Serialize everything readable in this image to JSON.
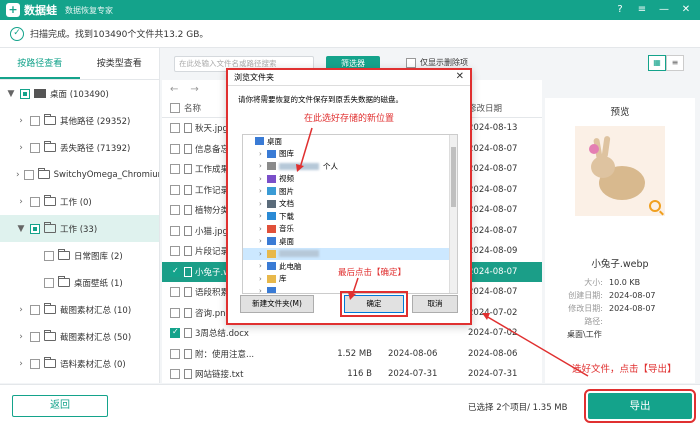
{
  "app": {
    "logo_glyph": "+",
    "name": "数据蛙",
    "subtitle": "数据恢复专家"
  },
  "window_controls": [
    "?",
    "≡",
    "—",
    "✕"
  ],
  "status": {
    "text": "扫描完成。找到103490个文件共13.2 GB。"
  },
  "left_tabs": [
    {
      "label": "按路径查看",
      "active": true
    },
    {
      "label": "按类型查看",
      "active": false
    }
  ],
  "tree": [
    {
      "label": "桌面 (103490)",
      "chevron": "▼",
      "check": "partial",
      "icon": "desktop"
    },
    {
      "label": "其他路径 (29352)",
      "chevron": "›",
      "check": "none",
      "icon": "folder"
    },
    {
      "label": "丢失路径 (71392)",
      "chevron": "›",
      "check": "none",
      "icon": "folder"
    },
    {
      "label": "SwitchyOmega_Chromium",
      "chevron": "›",
      "check": "none",
      "icon": "folder"
    },
    {
      "label": "工作 (0)",
      "chevron": "›",
      "check": "none",
      "icon": "folder"
    },
    {
      "label": "工作 (33)",
      "chevron": "▼",
      "check": "partial",
      "icon": "folder",
      "selected": true
    },
    {
      "label": "日常图库 (2)",
      "chevron": "",
      "check": "none",
      "icon": "folder"
    },
    {
      "label": "桌面壁纸 (1)",
      "chevron": "",
      "check": "none",
      "icon": "folder"
    },
    {
      "label": "截图素材汇总 (10)",
      "chevron": "›",
      "check": "none",
      "icon": "folder"
    },
    {
      "label": "截图素材汇总 (50)",
      "chevron": "›",
      "check": "none",
      "icon": "folder"
    },
    {
      "label": "语料素材汇总 (0)",
      "chevron": "›",
      "check": "none",
      "icon": "folder"
    }
  ],
  "toolbar": {
    "search_placeholder": "在此处输入文件名或路径搜索",
    "filter_label": "筛选器",
    "only_deleted_label": "仅显示删除项",
    "view_icons": [
      "▦",
      "≡"
    ]
  },
  "nav": {
    "back": "←",
    "forward": "→"
  },
  "file_list": {
    "headers": {
      "name": "名称",
      "size": "",
      "created": "",
      "modified": "修改日期"
    },
    "rows": [
      {
        "name": "秋天.jpg",
        "size": "",
        "created": "",
        "modified": "2024-08-13",
        "checked": false,
        "selected": false
      },
      {
        "name": "信息备忘.t",
        "size": "",
        "created": "",
        "modified": "2024-08-07",
        "checked": false,
        "selected": false
      },
      {
        "name": "工作成果分",
        "size": "",
        "created": "",
        "modified": "2024-08-07",
        "checked": false,
        "selected": false
      },
      {
        "name": "工作记录表",
        "size": "",
        "created": "",
        "modified": "2024-08-07",
        "checked": false,
        "selected": false
      },
      {
        "name": "植物分类.d",
        "size": "",
        "created": "",
        "modified": "2024-08-07",
        "checked": false,
        "selected": false
      },
      {
        "name": "小猫.jpg",
        "size": "",
        "created": "",
        "modified": "2024-08-07",
        "checked": false,
        "selected": false
      },
      {
        "name": "片段记录.c",
        "size": "",
        "created": "",
        "modified": "2024-08-09",
        "checked": false,
        "selected": false
      },
      {
        "name": "小兔子.we",
        "size": "",
        "created": "",
        "modified": "2024-08-07",
        "checked": true,
        "selected": true
      },
      {
        "name": "语段积累.d",
        "size": "",
        "created": "",
        "modified": "2024-08-07",
        "checked": false,
        "selected": false
      },
      {
        "name": "咨询.png",
        "size": "",
        "created": "",
        "modified": "2024-07-02",
        "checked": false,
        "selected": false
      },
      {
        "name": "3周总结.docx",
        "size": "",
        "created": "",
        "modified": "2024-07-02",
        "checked": true,
        "selected": false
      },
      {
        "name": "附：使用注意...",
        "size": "1.52 MB",
        "created": "2024-08-06",
        "modified": "2024-08-06",
        "checked": false,
        "selected": false
      },
      {
        "name": "网站链接.txt",
        "size": "116 B",
        "created": "2024-07-31",
        "modified": "2024-07-31",
        "checked": false,
        "selected": false
      },
      {
        "name": "U盘.png",
        "size": "70.7 KB",
        "created": "2024-07-02",
        "modified": "2024-07-02",
        "checked": false,
        "selected": false
      }
    ]
  },
  "preview": {
    "title": "预览",
    "filename": "小兔子.webp",
    "meta": [
      {
        "k": "大小:",
        "v": "10.0 KB"
      },
      {
        "k": "创建日期:",
        "v": "2024-08-07"
      },
      {
        "k": "修改日期:",
        "v": "2024-08-07"
      },
      {
        "k": "路径:",
        "v": ""
      }
    ],
    "path_value": "桌面\\工作"
  },
  "bottom": {
    "back_label": "返回",
    "selected_info": "已选择 2个项目/ 1.35 MB",
    "export_label": "导出",
    "annotation": "选好文件，点击【导出】"
  },
  "dialog": {
    "title": "浏览文件夹",
    "close": "✕",
    "message": "请你将需要恢复的文件保存到原丢失数据的磁盘。",
    "annotation": "在此选好存储的新位置",
    "tree": [
      {
        "label": "桌面",
        "indent": 0,
        "icon": "desktop",
        "hl": false
      },
      {
        "label": "图库",
        "indent": 1,
        "icon": "gallery",
        "hl": false
      },
      {
        "label": "个人",
        "indent": 1,
        "icon": "user",
        "hl": false,
        "blur": true
      },
      {
        "label": "视频",
        "indent": 1,
        "icon": "video",
        "hl": false
      },
      {
        "label": "图片",
        "indent": 1,
        "icon": "image",
        "hl": false
      },
      {
        "label": "文档",
        "indent": 1,
        "icon": "doc",
        "hl": false
      },
      {
        "label": "下载",
        "indent": 1,
        "icon": "download",
        "hl": false
      },
      {
        "label": "音乐",
        "indent": 1,
        "icon": "music",
        "hl": false
      },
      {
        "label": "桌面",
        "indent": 1,
        "icon": "desktop",
        "hl": false
      },
      {
        "label": "",
        "indent": 1,
        "icon": "folder",
        "hl": true,
        "blur": true
      },
      {
        "label": "此电脑",
        "indent": 1,
        "icon": "pc",
        "hl": false
      },
      {
        "label": "库",
        "indent": 1,
        "icon": "lib",
        "hl": false
      },
      {
        "label": "",
        "indent": 1,
        "icon": "net",
        "hl": false
      }
    ],
    "final_annotation": "最后点击【确定】",
    "new_folder_label": "新建文件夹(M)",
    "ok_label": "确定",
    "cancel_label": "取消"
  },
  "colors": {
    "accent": "#14a38b",
    "annotation_red": "#e03030"
  }
}
